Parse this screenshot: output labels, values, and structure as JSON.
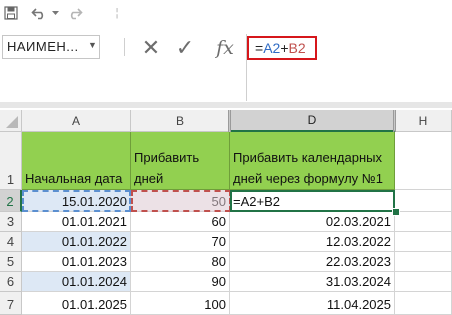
{
  "toolbar": {
    "icons": [
      "save-icon",
      "undo-icon",
      "undo-dropdown-icon",
      "redo-icon",
      "more-icon"
    ],
    "overflow_symbol": "¦"
  },
  "formula_bar": {
    "name_box": "НАИМЕН...",
    "cancel_symbol": "✕",
    "enter_symbol": "✓",
    "fx_label": "fx",
    "formula": {
      "prefix": "=",
      "ref1": "A2",
      "operator": "+",
      "ref2": "B2"
    }
  },
  "columns": [
    "A",
    "B",
    "D",
    "H"
  ],
  "rows": [
    "1",
    "2",
    "3",
    "4",
    "5",
    "6",
    "7"
  ],
  "header_row": {
    "a": "Начальная дата",
    "b": "Прибавить дней",
    "d": "Прибавить календарных дней через формулу №1"
  },
  "data_rows": [
    {
      "a": "15.01.2020",
      "b": "50",
      "d": "=A2+B2"
    },
    {
      "a": "01.01.2021",
      "b": "60",
      "d": "02.03.2021"
    },
    {
      "a": "01.01.2022",
      "b": "70",
      "d": "12.03.2022"
    },
    {
      "a": "01.01.2023",
      "b": "80",
      "d": "22.03.2023"
    },
    {
      "a": "01.01.2024",
      "b": "90",
      "d": "31.03.2024"
    },
    {
      "a": "01.01.2025",
      "b": "100",
      "d": "11.04.2025"
    }
  ],
  "colors": {
    "header_fill": "#92d050",
    "alt_row_fill": "#dde8f5",
    "active_border": "#217346",
    "highlight_red": "#d6161b"
  }
}
